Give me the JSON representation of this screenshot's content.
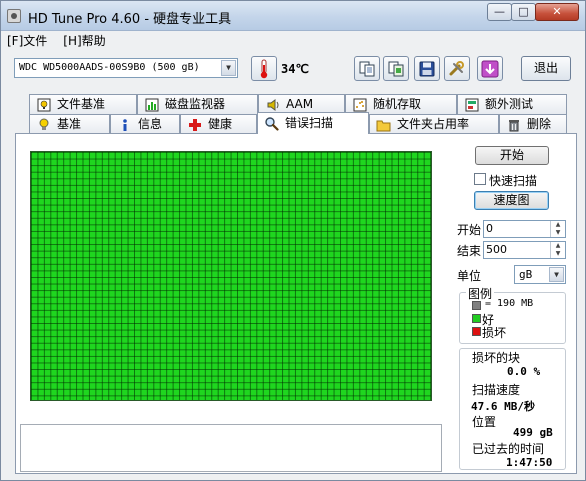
{
  "window": {
    "title": "HD Tune Pro 4.60 - 硬盘专业工具",
    "minimize": "—",
    "maximize": "□",
    "close": "✕"
  },
  "menu": {
    "file": "[F]文件",
    "help": "[H]帮助"
  },
  "toolbar": {
    "drive": "WDC WD5000AADS-00S9B0 (500 gB)",
    "temperature": "34℃",
    "exit": "退出"
  },
  "tabs": {
    "row1": [
      "文件基准",
      "磁盘监视器",
      "AAM",
      "随机存取",
      "额外测试"
    ],
    "row2": [
      "基准",
      "信息",
      "健康",
      "错误扫描",
      "文件夹占用率",
      "删除"
    ],
    "active": "错误扫描"
  },
  "scan": {
    "start_button": "开始",
    "quick_scan_label": "快速扫描",
    "quick_scan_checked": false,
    "speed_map_button": "速度图",
    "start_label": "开始",
    "start_value": "0",
    "end_label": "结束",
    "end_value": "500",
    "unit_label": "单位",
    "unit_value": "gB",
    "block_state": "all good"
  },
  "legend": {
    "title": "图例",
    "block_size": "= 190 MB",
    "good": "好",
    "damaged": "损坏",
    "colors": {
      "block": "#808080",
      "good": "#22cc22",
      "damaged": "#dd1111"
    }
  },
  "stats": {
    "damaged_blocks_label": "损坏的块",
    "damaged_blocks_value": "0.0 %",
    "scan_speed_label": "扫描速度",
    "scan_speed_value": "47.6 MB/秒",
    "position_label": "位置",
    "position_value": "499 gB",
    "elapsed_label": "已过去的时间",
    "elapsed_value": "1:47:50"
  }
}
